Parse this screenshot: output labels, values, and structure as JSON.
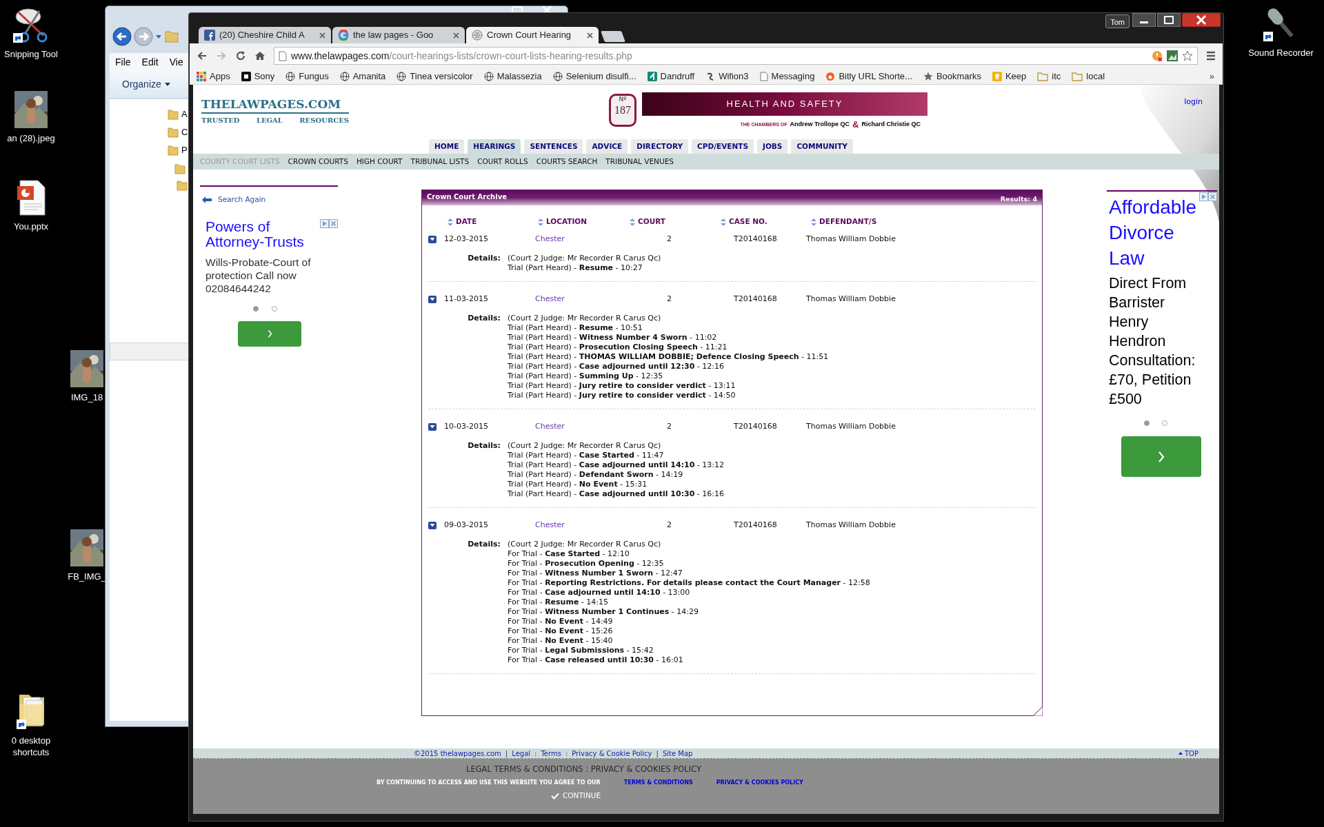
{
  "desktop_icons": [
    {
      "label": "Snipping Tool",
      "kind": "scissors"
    },
    {
      "label": "an (28).jpeg"
    },
    {
      "label": "You.pptx",
      "kind": "slides"
    },
    {
      "label": "IMG_18"
    },
    {
      "label": "FB_IMG_"
    },
    {
      "label": "0 desktop shortcuts",
      "kind": "folder"
    },
    {
      "label": "Sound Recorder",
      "kind": "microphone"
    }
  ],
  "explorer": {
    "menu": [
      "File",
      "Edit",
      "Vie"
    ],
    "organize": "Organize",
    "tree_items": [
      "A",
      "C",
      "P"
    ]
  },
  "browser": {
    "user": "Tom",
    "tabs": [
      {
        "title": "(20) Cheshire Child A",
        "kind": "facebook",
        "selected": false
      },
      {
        "title": "the law pages - Goo",
        "kind": "google",
        "selected": false
      },
      {
        "title": "Crown Court Hearing",
        "kind": "site",
        "selected": true
      }
    ],
    "url": {
      "host": "www.thelawpages.com",
      "path": "/court-hearings-lists/crown-court-lists-hearing-results.php"
    },
    "bookmarks": [
      {
        "label": "Apps",
        "kind": "apps"
      },
      {
        "label": "Sony",
        "kind": "square"
      },
      {
        "label": "Fungus",
        "kind": "globe"
      },
      {
        "label": "Amanita",
        "kind": "globe"
      },
      {
        "label": "Tinea versicolor",
        "kind": "globe"
      },
      {
        "label": "Malassezia",
        "kind": "globe"
      },
      {
        "label": "Selenium disulfi...",
        "kind": "globe"
      },
      {
        "label": "Dandruff",
        "kind": "teal"
      },
      {
        "label": "Wifion3",
        "kind": "swirl"
      },
      {
        "label": "Messaging",
        "kind": "page"
      },
      {
        "label": "Bitly URL Shorte...",
        "kind": "bitly"
      },
      {
        "label": "Bookmarks",
        "kind": "star"
      },
      {
        "label": "Keep",
        "kind": "bulb"
      },
      {
        "label": "itc",
        "kind": "folder"
      },
      {
        "label": "local",
        "kind": "folder"
      }
    ],
    "more": "»"
  },
  "site": {
    "logo": "THELAWPAGES.COM",
    "tagline": [
      "TRUSTED",
      "LEGAL",
      "RESOURCES"
    ],
    "login": "login"
  },
  "banner": {
    "badge_label": "Nº",
    "badge_number": "187",
    "heading": "HEALTH AND SAFETY",
    "chambers": "THE CHAMBERS OF",
    "barrister_1": "Andrew Trollope QC",
    "ampersand": "&",
    "barrister_2": "Richard Christie QC"
  },
  "nav": [
    {
      "label": "HOME",
      "selected": false
    },
    {
      "label": "HEARINGS",
      "selected": true
    },
    {
      "label": "SENTENCES",
      "selected": false
    },
    {
      "label": "ADVICE",
      "selected": false
    },
    {
      "label": "DIRECTORY",
      "selected": false
    },
    {
      "label": "CPD/EVENTS",
      "selected": false
    },
    {
      "label": "JOBS",
      "selected": false
    },
    {
      "label": "COMMUNITY",
      "selected": false
    }
  ],
  "subnav": [
    {
      "label": "COUNTY COURT LISTS",
      "selected": true
    },
    {
      "label": "CROWN COURTS",
      "selected": false
    },
    {
      "label": "HIGH COURT",
      "selected": false
    },
    {
      "label": "TRIBUNAL LISTS",
      "selected": false
    },
    {
      "label": "COURT ROLLS",
      "selected": false
    },
    {
      "label": "COURTS SEARCH",
      "selected": false
    },
    {
      "label": "TRIBUNAL VENUES",
      "selected": false
    }
  ],
  "search_again": "Search Again",
  "ad_left": {
    "title": "Powers of Attorney-Trusts",
    "body": "Wills-Probate-Court of protection Call now 02084644242",
    "dots": [
      {
        "selected": true
      },
      {
        "selected": false
      }
    ]
  },
  "archive": {
    "title": "Crown Court Archive",
    "results": "Results: 4",
    "columns": [
      "DATE",
      "LOCATION",
      "COURT",
      "CASE NO.",
      "DEFENDANT/S"
    ],
    "rows": [
      {
        "date": "12-03-2015",
        "location": "Chester",
        "court": "2",
        "case_no": "T20140168",
        "defendant": "Thomas William Dobbie",
        "expanded": true,
        "details_label": "Details:",
        "details": [
          "(Court 2 Judge: Mr Recorder R Carus Qc)",
          "Trial (Part Heard) - **Resume** - 10:27"
        ]
      },
      {
        "date": "11-03-2015",
        "location": "Chester",
        "court": "2",
        "case_no": "T20140168",
        "defendant": "Thomas William Dobbie",
        "expanded": true,
        "details_label": "Details:",
        "details": [
          "(Court 2 Judge: Mr Recorder R Carus Qc)",
          "Trial (Part Heard) - **Resume** - 10:51",
          "Trial (Part Heard) - **Witness Number 4 Sworn** - 11:02",
          "Trial (Part Heard) - **Prosecution Closing Speech** - 11:21",
          "Trial (Part Heard) - **THOMAS WILLIAM DOBBIE; Defence Closing Speech** - 11:51",
          "Trial (Part Heard) - **Case adjourned until 12:30** - 12:16",
          "Trial (Part Heard) - **Summing Up** - 12:35",
          "Trial (Part Heard) - **Jury retire to consider verdict** - 13:11",
          "Trial (Part Heard) - **Jury retire to consider verdict** - 14:50"
        ]
      },
      {
        "date": "10-03-2015",
        "location": "Chester",
        "court": "2",
        "case_no": "T20140168",
        "defendant": "Thomas William Dobbie",
        "expanded": true,
        "details_label": "Details:",
        "details": [
          "(Court 2 Judge: Mr Recorder R Carus Qc)",
          "Trial (Part Heard) - **Case Started** - 11:47",
          "Trial (Part Heard) - **Case adjourned until 14:10** - 13:12",
          "Trial (Part Heard) - **Defendant Sworn** - 14:19",
          "Trial (Part Heard) - **No Event** - 15:31",
          "Trial (Part Heard) - **Case adjourned until 10:30** - 16:16"
        ]
      },
      {
        "date": "09-03-2015",
        "location": "Chester",
        "court": "2",
        "case_no": "T20140168",
        "defendant": "Thomas William Dobbie",
        "expanded": true,
        "details_label": "Details:",
        "details": [
          "(Court 2 Judge: Mr Recorder R Carus Qc)",
          "For Trial - **Case Started** - 12:10",
          "For Trial - **Prosecution Opening** - 12:35",
          "For Trial - **Witness Number 1 Sworn** - 12:47",
          "For Trial - **Reporting Restrictions. For details please contact the Court Manager** - 12:58",
          "For Trial - **Case adjourned until 14:10** - 13:00",
          "For Trial - **Resume** - 14:15",
          "For Trial - **Witness Number 1 Continues** - 14:29",
          "For Trial - **No Event** - 14:49",
          "For Trial - **No Event** - 15:26",
          "For Trial - **No Event** - 15:40",
          "For Trial - **Legal Submissions** - 15:42",
          "For Trial - **Case released until 10:30** - 16:01"
        ]
      }
    ]
  },
  "ad_right": {
    "title": "Affordable Divorce Law",
    "body": "Direct From Barrister Henry Hendron Consultation: £70, Petition £500",
    "dots": [
      {
        "selected": true
      },
      {
        "selected": false
      }
    ]
  },
  "footer": {
    "links": [
      {
        "kind": "link",
        "text": "©2015 thelawpages.com"
      },
      {
        "kind": "sep",
        "text": "|"
      },
      {
        "kind": "link",
        "text": "Legal"
      },
      {
        "kind": "sep",
        "text": ":"
      },
      {
        "kind": "link",
        "text": "Terms"
      },
      {
        "kind": "sep",
        "text": ":"
      },
      {
        "kind": "link",
        "text": "Privacy & Cookie Policy"
      },
      {
        "kind": "sep",
        "text": "|"
      },
      {
        "kind": "link",
        "text": "Site Map"
      }
    ],
    "top": "TOP"
  },
  "cookie_notice": {
    "title": "LEGAL TERMS & CONDITIONS : PRIVACY & COOKIES POLICY",
    "notice": "BY CONTINUING TO ACCESS AND USE THIS WEBSITE YOU AGREE TO OUR",
    "links": [
      "TERMS & CONDITIONS",
      "PRIVACY & COOKIES POLICY"
    ],
    "continue": "CONTINUE"
  }
}
